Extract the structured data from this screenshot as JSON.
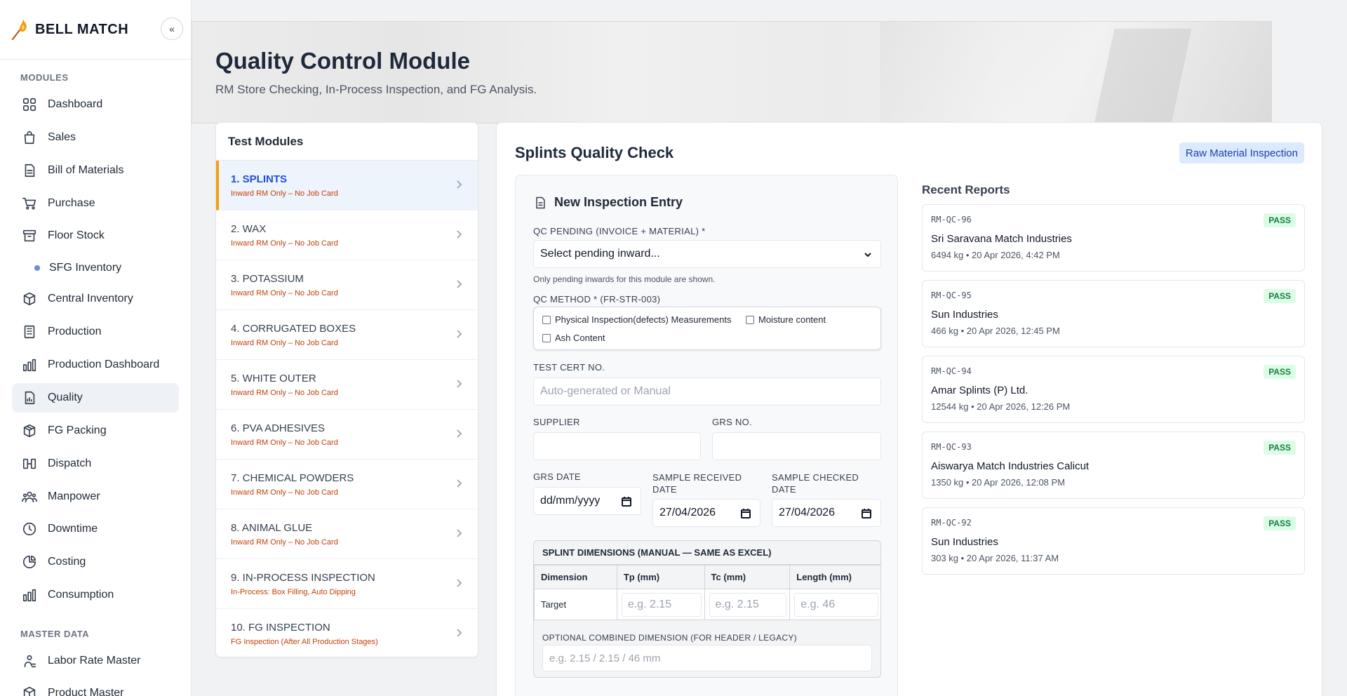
{
  "brand": {
    "name": "BELL MATCH",
    "collapse_glyph": "«"
  },
  "sidebar": {
    "modules_heading": "MODULES",
    "items": [
      {
        "label": "Dashboard",
        "icon": "grid-icon"
      },
      {
        "label": "Sales",
        "icon": "shopping-bag-icon"
      },
      {
        "label": "Bill of Materials",
        "icon": "document-icon"
      },
      {
        "label": "Purchase",
        "icon": "cart-icon"
      },
      {
        "label": "Floor Stock",
        "icon": "archive-icon"
      },
      {
        "label": "SFG Inventory",
        "icon": "dot-icon"
      },
      {
        "label": "Central Inventory",
        "icon": "box-icon"
      },
      {
        "label": "Production",
        "icon": "building-icon"
      },
      {
        "label": "Production Dashboard",
        "icon": "bar-chart-icon"
      },
      {
        "label": "Quality",
        "icon": "report-icon"
      },
      {
        "label": "FG Packing",
        "icon": "package-icon"
      },
      {
        "label": "Dispatch",
        "icon": "dispatch-icon"
      },
      {
        "label": "Manpower",
        "icon": "users-icon"
      },
      {
        "label": "Downtime",
        "icon": "clock-icon"
      },
      {
        "label": "Costing",
        "icon": "pie-chart-icon"
      },
      {
        "label": "Consumption",
        "icon": "bar-chart-icon"
      }
    ],
    "master_heading": "MASTER DATA",
    "master_items": [
      {
        "label": "Labor Rate Master",
        "icon": "user-cog-icon"
      },
      {
        "label": "Product Master",
        "icon": "box-icon"
      }
    ]
  },
  "header": {
    "title": "Quality Control Module",
    "subtitle": "RM Store Checking, In-Process Inspection, and FG Analysis."
  },
  "modules_panel": {
    "title": "Test Modules",
    "items": [
      {
        "name": "1. SPLINTS",
        "sub": "Inward RM Only – No Job Card"
      },
      {
        "name": "2. WAX",
        "sub": "Inward RM Only – No Job Card"
      },
      {
        "name": "3. POTASSIUM",
        "sub": "Inward RM Only – No Job Card"
      },
      {
        "name": "4. CORRUGATED BOXES",
        "sub": "Inward RM Only – No Job Card"
      },
      {
        "name": "5. WHITE OUTER",
        "sub": "Inward RM Only – No Job Card"
      },
      {
        "name": "6. PVA ADHESIVES",
        "sub": "Inward RM Only – No Job Card"
      },
      {
        "name": "7. CHEMICAL POWDERS",
        "sub": "Inward RM Only – No Job Card"
      },
      {
        "name": "8. ANIMAL GLUE",
        "sub": "Inward RM Only – No Job Card"
      },
      {
        "name": "9. IN-PROCESS INSPECTION",
        "sub": "In-Process: Box Filling, Auto Dipping"
      },
      {
        "name": "10. FG INSPECTION",
        "sub": "FG Inspection (After All Production Stages)"
      }
    ]
  },
  "form": {
    "title": "Splints Quality Check",
    "badge": "Raw Material Inspection",
    "entry_title": "New Inspection Entry",
    "qc_pending_label": "QC PENDING (INVOICE + MATERIAL) *",
    "qc_pending_value": "Select pending inward...",
    "qc_pending_helper": "Only pending inwards for this module are shown.",
    "qc_method_label": "QC METHOD * (FR-STR-003)",
    "methods": [
      "Physical Inspection(defects) Measurements",
      "Moisture content",
      "Ash Content"
    ],
    "test_cert_label": "TEST CERT NO.",
    "test_cert_placeholder": "Auto-generated or Manual",
    "supplier_label": "SUPPLIER",
    "supplier_value": "",
    "grs_no_label": "GRS NO.",
    "grs_no_value": "",
    "grs_date_label": "GRS DATE",
    "grs_date_value": "dd/mm/yyyy",
    "sample_received_label": "SAMPLE RECEIVED DATE",
    "sample_received_value": "27/04/2026",
    "sample_checked_label": "SAMPLE CHECKED DATE",
    "sample_checked_value": "27/04/2026",
    "dimensions": {
      "heading": "SPLINT DIMENSIONS (MANUAL — SAME AS EXCEL)",
      "columns": [
        "Dimension",
        "Tp (mm)",
        "Tc (mm)",
        "Length (mm)"
      ],
      "row_label": "Target",
      "placeholders": [
        "e.g. 2.15",
        "e.g. 2.15",
        "e.g. 46"
      ],
      "optional_label": "OPTIONAL COMBINED DIMENSION (FOR HEADER / LEGACY)",
      "optional_placeholder": "e.g. 2.15 / 2.15 / 46 mm"
    }
  },
  "recent": {
    "title": "Recent Reports",
    "reports": [
      {
        "id": "RM-QC-96",
        "name": "Sri Saravana Match Industries",
        "meta": "6494 kg • 20 Apr 2026, 4:42 PM",
        "status": "PASS"
      },
      {
        "id": "RM-QC-95",
        "name": "Sun Industries",
        "meta": "466 kg • 20 Apr 2026, 12:45 PM",
        "status": "PASS"
      },
      {
        "id": "RM-QC-94",
        "name": "Amar Splints (P) Ltd.",
        "meta": "12544 kg • 20 Apr 2026, 12:26 PM",
        "status": "PASS"
      },
      {
        "id": "RM-QC-93",
        "name": "Aiswarya Match Industries Calicut",
        "meta": "1350 kg • 20 Apr 2026, 12:08 PM",
        "status": "PASS"
      },
      {
        "id": "RM-QC-92",
        "name": "Sun Industries",
        "meta": "303 kg • 20 Apr 2026, 11:37 AM",
        "status": "PASS"
      }
    ]
  },
  "colors": {
    "accent": "#1d4ed8",
    "active_border": "#f59e0b",
    "pass_bg": "#dcfce7",
    "pass_text": "#15803d",
    "sub_text": "#c2410c"
  }
}
